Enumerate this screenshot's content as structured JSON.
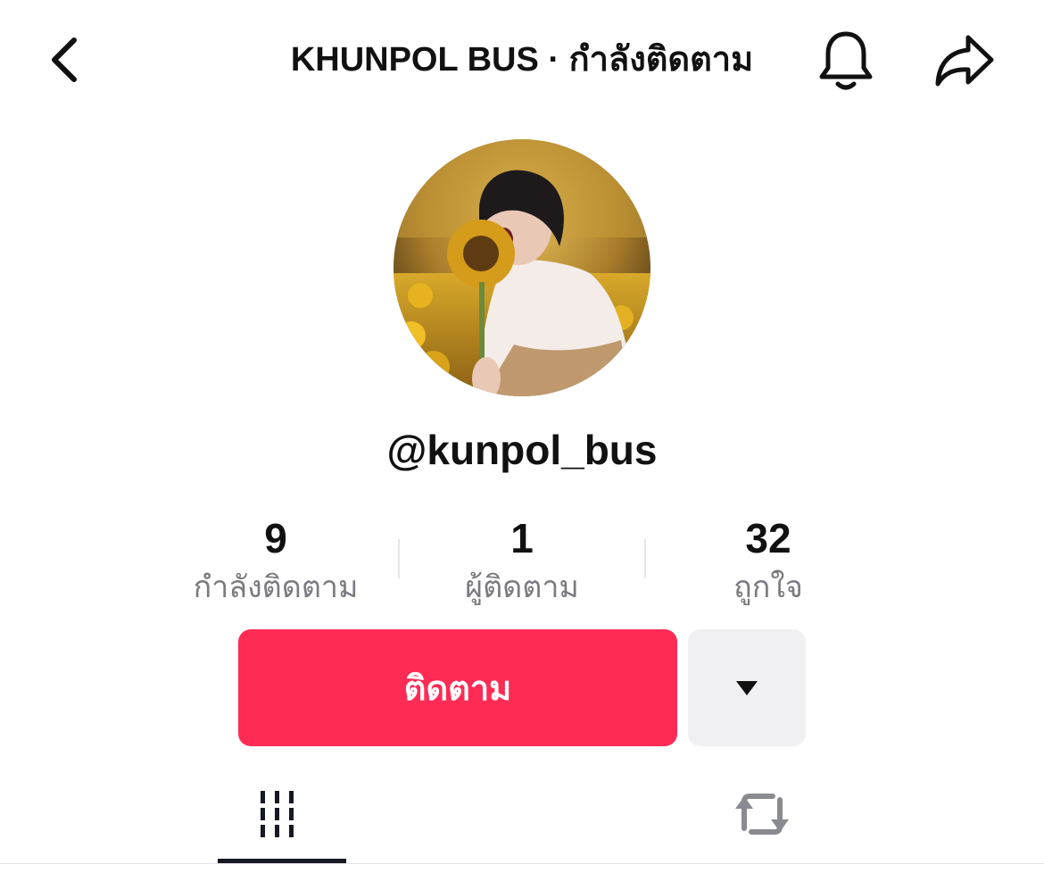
{
  "header": {
    "title": "KHUNPOL BUS · กำลังติดตาม",
    "back_icon": "chevron-left-icon",
    "bell_icon": "bell-icon",
    "share_icon": "share-arrow-icon"
  },
  "profile": {
    "username": "@kunpol_bus"
  },
  "stats": [
    {
      "value": "9",
      "label": "กำลังติดตาม"
    },
    {
      "value": "1",
      "label": "ผู้ติดตาม"
    },
    {
      "value": "32",
      "label": "ถูกใจ"
    }
  ],
  "actions": {
    "follow_label": "ติดตาม",
    "more_icon": "caret-down-icon"
  },
  "tabs": [
    {
      "icon": "grid-videos-icon",
      "selected": true
    },
    {
      "icon": "repost-icon",
      "selected": false
    }
  ],
  "colors": {
    "accent": "#fe2c55",
    "secondary_button": "#f0f0f2",
    "muted_text": "#7a7a80"
  }
}
